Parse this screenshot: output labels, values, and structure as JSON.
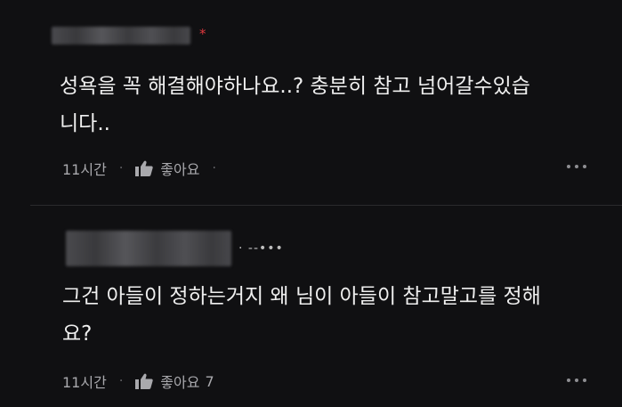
{
  "comments": [
    {
      "author_mark": "*",
      "author_extra": "",
      "text": "성욕을 꼭 해결해야하나요..? 충분히 참고 넘어갈수있습\n니다..",
      "time": "11시간",
      "like_label": "좋아요",
      "like_count": ""
    },
    {
      "author_mark": "",
      "author_extra": "· --•••",
      "text": "그건 아들이 정하는거지 왜 님이 아들이 참고말고를 정해\n요?",
      "time": "11시간",
      "like_label": "좋아요",
      "like_count": "7"
    }
  ],
  "icons": {
    "like": "thumbs-up-icon",
    "more": "more-horizontal-icon"
  },
  "colors": {
    "background": "#101012",
    "author_mark": "#e0383e",
    "meta_text": "#a9a9ad"
  }
}
